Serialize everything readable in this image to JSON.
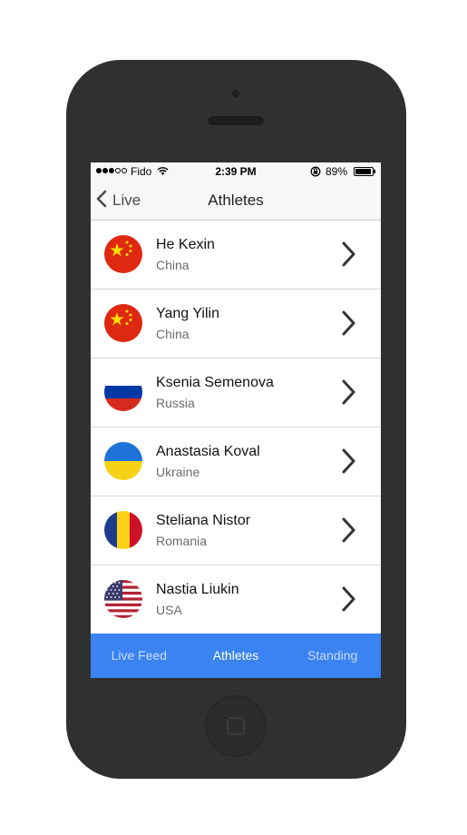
{
  "status_bar": {
    "carrier": "Fido",
    "time": "2:39 PM",
    "battery": "89%",
    "signal_bars_filled": 3,
    "signal_bars_total": 5
  },
  "nav": {
    "back_label": "Live",
    "title": "Athletes"
  },
  "athletes": [
    {
      "name": "He Kexin",
      "country": "China",
      "flag": "china-flag-icon"
    },
    {
      "name": "Yang Yilin",
      "country": "China",
      "flag": "china-flag-icon"
    },
    {
      "name": "Ksenia Semenova",
      "country": "Russia",
      "flag": "russia-flag-icon"
    },
    {
      "name": "Anastasia Koval",
      "country": "Ukraine",
      "flag": "ukraine-flag-icon"
    },
    {
      "name": "Steliana Nistor",
      "country": "Romania",
      "flag": "romania-flag-icon"
    },
    {
      "name": "Nastia Liukin",
      "country": "USA",
      "flag": "usa-flag-icon"
    }
  ],
  "tab_bar": {
    "tabs": [
      {
        "label": "Live Feed",
        "active": false
      },
      {
        "label": "Athletes",
        "active": true
      },
      {
        "label": "Standing",
        "active": false
      }
    ]
  },
  "colors": {
    "tab_bar": "#3a83f1",
    "device_body": "#2f3130"
  }
}
